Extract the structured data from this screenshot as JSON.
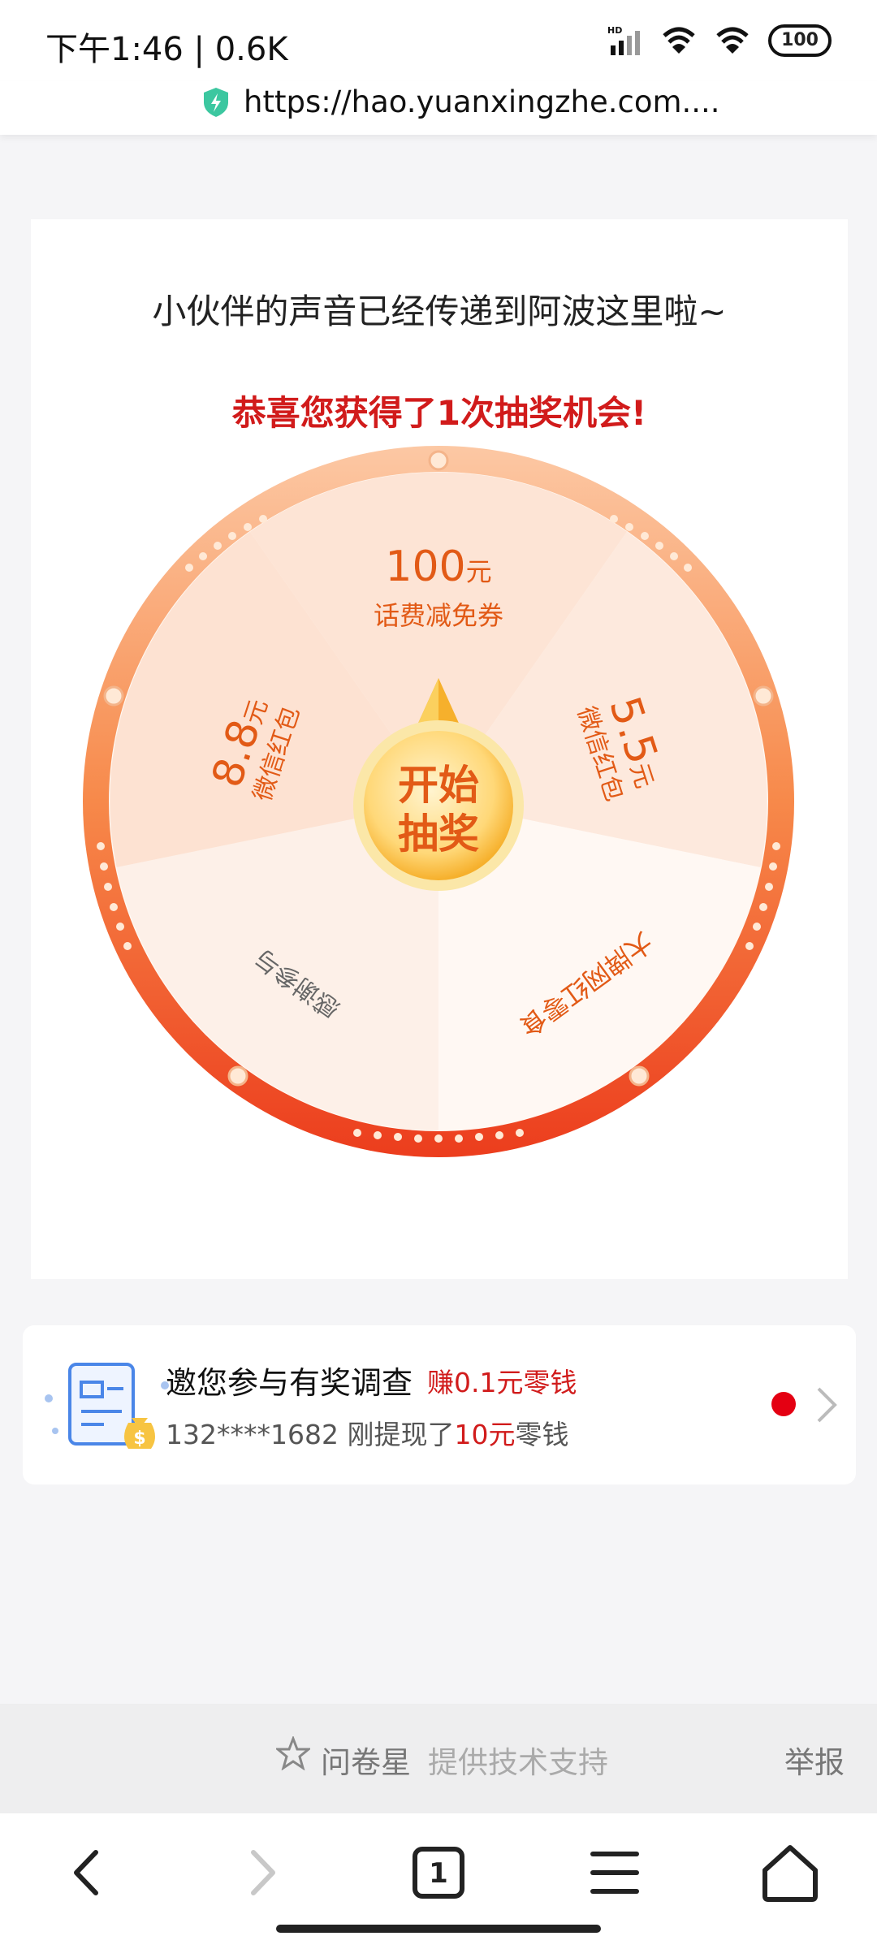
{
  "status_bar": {
    "time_speed": "下午1:46 | 0.6K",
    "battery": "100",
    "network_badge": "HD"
  },
  "url_bar": {
    "url": "https://hao.yuanxingzhe.com...."
  },
  "main": {
    "title": "小伙伴的声音已经传递到阿波这里啦~",
    "subtitle": "恭喜您获得了1次抽奖机会!",
    "wheel": {
      "prize_top_amount": "100",
      "prize_top_unit": "元",
      "prize_top_label": "话费减免券",
      "prize_left_amount": "8.8",
      "prize_left_unit": "元",
      "prize_left_label": "微信红包",
      "prize_right_amount": "5.5",
      "prize_right_unit": "元",
      "prize_right_label": "微信红包",
      "prize_bottom_right": "大牌网红零食",
      "prize_bottom_left": "感谢参与",
      "start_button_line1": "开始",
      "start_button_line2": "抽奖"
    }
  },
  "survey_card": {
    "title": "邀您参与有奖调查",
    "earn": "赚0.1元零钱",
    "sub_prefix": "132****1682 刚提现了",
    "sub_amount": "10元",
    "sub_suffix": "零钱"
  },
  "footer": {
    "brand": "问卷星",
    "support": "提供技术支持",
    "report": "举报"
  },
  "bottom_nav": {
    "tab_count": "1"
  },
  "colors": {
    "accent_red": "#d11b1b",
    "wheel_orange": "#f05a24",
    "prize_text": "#e25a16",
    "gold": "#f7b733"
  }
}
